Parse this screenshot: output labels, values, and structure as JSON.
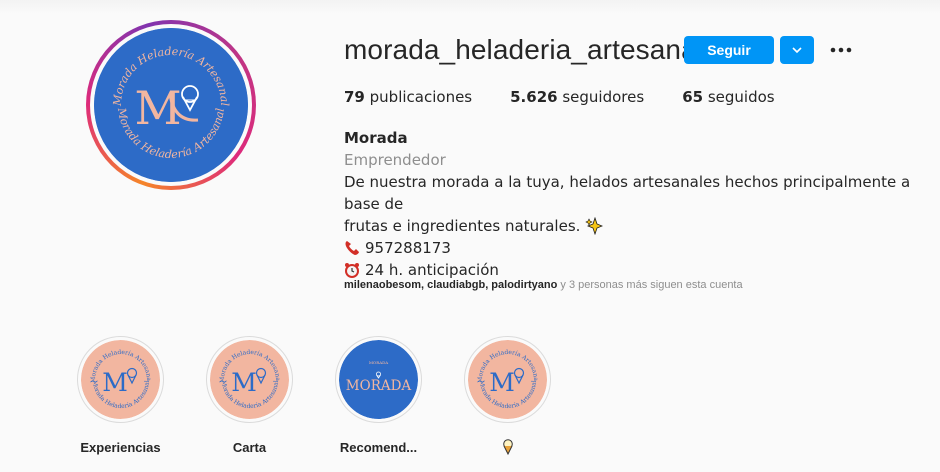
{
  "profile": {
    "username": "morada_heladeria_artesanal",
    "avatar_text_top": "Morada Heladería Artesanal",
    "avatar_text_bottom": "Morada Heladería Artesanal",
    "avatar_monogram": "M"
  },
  "actions": {
    "follow_label": "Seguir",
    "dropdown_icon": "chevron-down-icon",
    "more_icon": "ellipsis-icon"
  },
  "stats": {
    "posts_count": "79",
    "posts_label": "publicaciones",
    "followers_count": "5.626",
    "followers_label": "seguidores",
    "following_count": "65",
    "following_label": "seguidos"
  },
  "bio": {
    "name": "Morada",
    "category": "Emprendedor",
    "description_line1": "De nuestra morada a la tuya, helados artesanales hechos principalmente a base de",
    "description_line2": "frutas e ingredientes naturales.",
    "phone_icon": "telephone-icon",
    "phone": "957288173",
    "clock_icon": "alarm-clock-icon",
    "notice": "24 h. anticipación",
    "sparkle_icon": "sparkles-icon"
  },
  "followed_by": {
    "names": "milenaobesom, claudiabgb, palodirtyano",
    "rest": " y 3 personas más siguen esta cuenta"
  },
  "highlights": [
    {
      "label": "Experiencias",
      "cover_text": "Morada Heladería Artesanal",
      "monogram": "M"
    },
    {
      "label": "Carta",
      "cover_text": "Morada Heladería Artesanal",
      "monogram": "M"
    },
    {
      "label": "Recomend...",
      "cover_text": "MORADA",
      "monogram": "MORADA"
    },
    {
      "label": "",
      "cover_text": "Morada Heladería Artesanal",
      "monogram": "M",
      "label_icon": "ice-cream-icon"
    }
  ],
  "colors": {
    "brand_blue": "#2d6bc7",
    "peach": "#f2b6a0",
    "button_blue": "#0095f6"
  }
}
